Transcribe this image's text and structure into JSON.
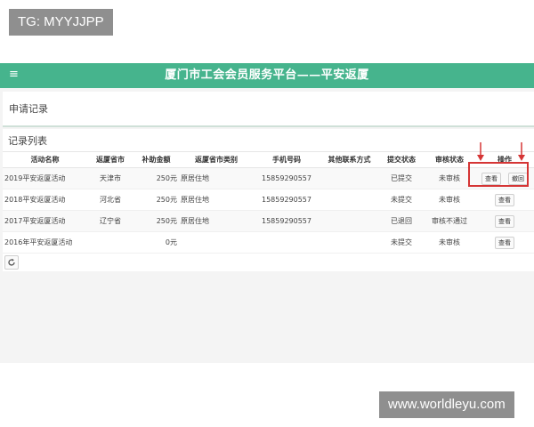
{
  "watermarks": {
    "top": "TG: MYYJJPP",
    "bottom": "www.worldleyu.com"
  },
  "header": {
    "menu_icon": "≡",
    "title": "厦门市工会会员服务平台——平安返厦"
  },
  "panel": {
    "title": "申请记录"
  },
  "records": {
    "title": "记录列表",
    "columns": [
      "活动名称",
      "返厦省市",
      "补助金额",
      "返厦省市类别",
      "手机号码",
      "其他联系方式",
      "提交状态",
      "审核状态",
      "操作"
    ],
    "rows": [
      {
        "activity": "2019平安返厦活动",
        "province": "天津市",
        "amount": "250元",
        "category": "原居住地",
        "phone": "15859290557",
        "other": "",
        "submit": "已提交",
        "review": "未审核",
        "actions": [
          "查看",
          "撤回"
        ]
      },
      {
        "activity": "2018平安返厦活动",
        "province": "河北省",
        "amount": "250元",
        "category": "原居住地",
        "phone": "15859290557",
        "other": "",
        "submit": "未提交",
        "review": "未审核",
        "actions": [
          "查看"
        ]
      },
      {
        "activity": "2017平安返厦活动",
        "province": "辽宁省",
        "amount": "250元",
        "category": "原居住地",
        "phone": "15859290557",
        "other": "",
        "submit": "已退回",
        "review": "审核不通过",
        "actions": [
          "查看"
        ]
      },
      {
        "activity": "2016年平安返厦活动",
        "province": "",
        "amount": "0元",
        "category": "",
        "phone": "",
        "other": "",
        "submit": "未提交",
        "review": "未审核",
        "actions": [
          "查看"
        ]
      }
    ]
  },
  "icons": {
    "menu": "menu-icon",
    "refresh": "refresh-icon"
  },
  "colors": {
    "topbar": "#46b48d",
    "highlight": "#d53535"
  }
}
